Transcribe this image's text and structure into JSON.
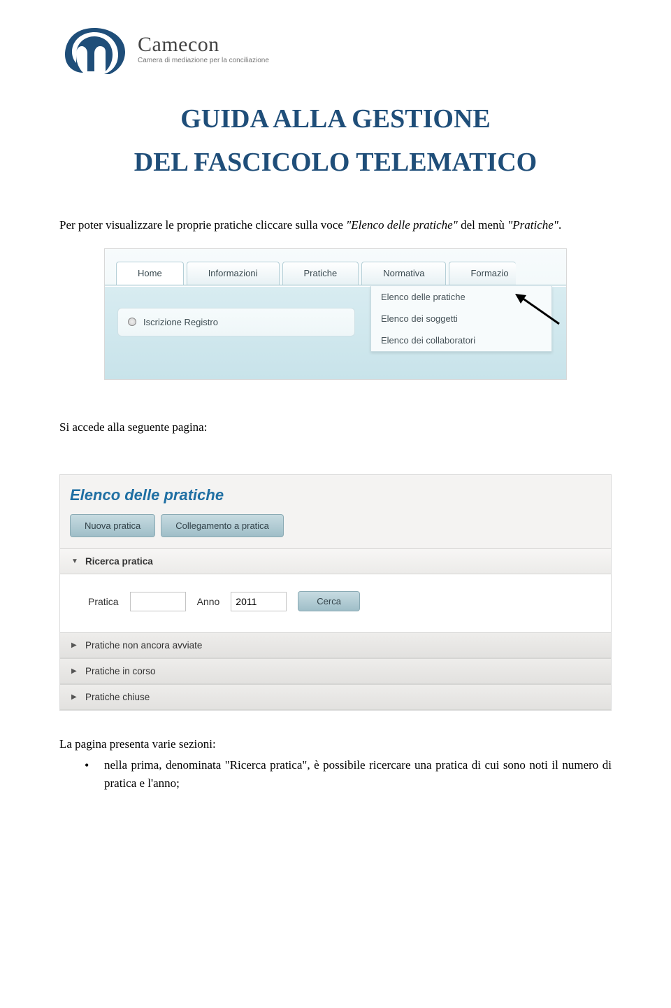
{
  "logo": {
    "brand": "Camecon",
    "tagline": "Camera di mediazione per la conciliazione"
  },
  "title_line1": "GUIDA ALLA GESTIONE",
  "title_line2": "DEL FASCICOLO TELEMATICO",
  "intro_a": "Per poter visualizzare le proprie pratiche cliccare sulla voce ",
  "intro_b": "\"Elenco delle pratiche\"",
  "intro_c": " del menù ",
  "intro_d": "\"Pratiche\"",
  "intro_e": ".",
  "shot1": {
    "tabs": [
      "Home",
      "Informazioni",
      "Pratiche",
      "Normativa",
      "Formazio"
    ],
    "side_label": "Iscrizione Registro",
    "dropdown": [
      "Elenco delle pratiche",
      "Elenco dei soggetti",
      "Elenco dei collaboratori"
    ]
  },
  "mid_text": "Si accede alla seguente pagina:",
  "shot2": {
    "heading": "Elenco delle pratiche",
    "btn_new": "Nuova pratica",
    "btn_link": "Collegamento a pratica",
    "acc_search": "Ricerca pratica",
    "lbl_pratica": "Pratica",
    "lbl_anno": "Anno",
    "val_pratica": "",
    "val_anno": "2011",
    "btn_search": "Cerca",
    "acc_pending": "Pratiche non ancora avviate",
    "acc_running": "Pratiche in corso",
    "acc_closed": "Pratiche chiuse"
  },
  "outro_a": "La pagina presenta varie sezioni:",
  "bullet_a": "nella prima, denominata ",
  "bullet_b": "\"Ricerca pratica\"",
  "bullet_c": ", è possibile ricercare una pratica di cui sono noti il numero di pratica e l'anno;"
}
